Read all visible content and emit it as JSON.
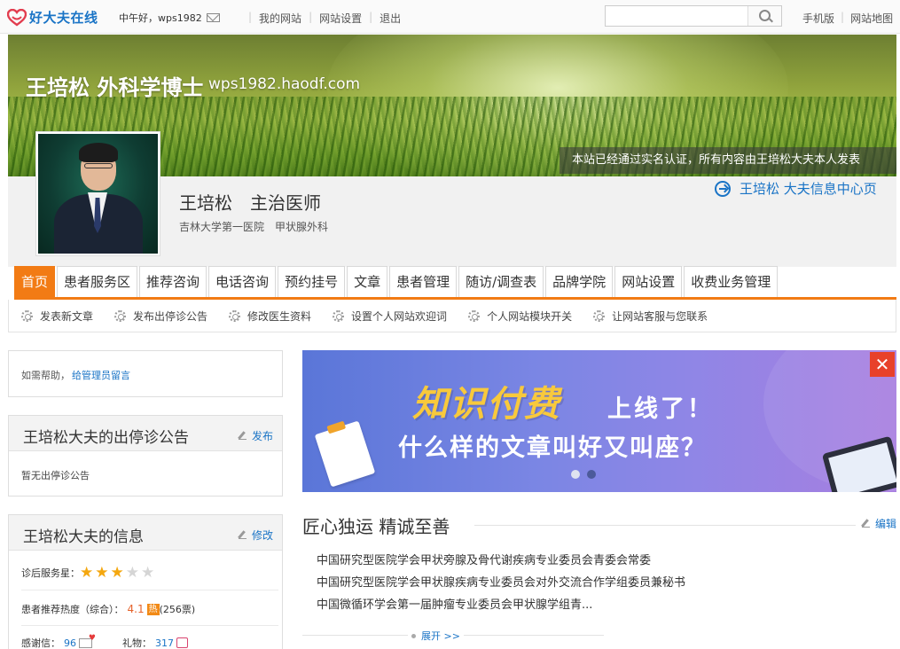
{
  "topbar": {
    "logo_text": "好大夫在线",
    "greeting": "中午好，wps1982",
    "links": [
      "我的网站",
      "网站设置",
      "退出"
    ],
    "search_placeholder": "",
    "right_links": [
      "手机版",
      "网站地图"
    ]
  },
  "banner": {
    "title": "王培松 外科学博士",
    "domain": "wps1982.haodf.com",
    "verify_text": "本站已经通过实名认证，所有内容由王培松大夫本人发表"
  },
  "profile": {
    "name_title": "王培松　主治医师",
    "hospital": "吉林大学第一医院　甲状腺外科",
    "info_center_link": "王培松 大夫信息中心页"
  },
  "nav": {
    "tabs": [
      "首页",
      "患者服务区",
      "推荐咨询",
      "电话咨询",
      "预约挂号",
      "文章",
      "患者管理",
      "随访/调查表",
      "品牌学院",
      "网站设置",
      "收费业务管理"
    ],
    "active": 0
  },
  "subbar": {
    "items": [
      "发表新文章",
      "发布出停诊公告",
      "修改医生资料",
      "设置个人网站欢迎词",
      "个人网站模块开关",
      "让网站客服与您联系"
    ]
  },
  "help": {
    "prefix": "如需帮助，",
    "link": "给管理员留言"
  },
  "notice": {
    "title": "王培松大夫的出停诊公告",
    "action": "发布",
    "body": "暂无出停诊公告"
  },
  "info": {
    "title": "王培松大夫的信息",
    "action": "修改",
    "service_stars_label": "诊后服务星：",
    "stars_filled": 3,
    "stars_total": 5,
    "hot_label": "患者推荐热度（综合）：",
    "hot_value": "4.1",
    "hot_badge": "热",
    "hot_votes": "(256票)",
    "thanks_label": "感谢信：",
    "thanks_value": "96",
    "gift_label": "礼物：",
    "gift_value": "317"
  },
  "promo": {
    "line1_highlight": "知识付费",
    "line1_rest": "上线了！",
    "line2": "什么样的文章叫好又叫座？",
    "close": "✕",
    "slides": 2,
    "active_slide": 1
  },
  "section": {
    "title": "匠心独运 精诚至善",
    "edit": "编辑",
    "bio": [
      "中国研究型医院学会甲状旁腺及骨代谢疾病专业委员会青委会常委",
      "中国研究型医院学会甲状腺疾病专业委员会对外交流合作学组委员兼秘书",
      "中国微循环学会第一届肿瘤专业委员会甲状腺学组青..."
    ],
    "expand": "展开 >>"
  },
  "colors": {
    "brand_blue": "#1a74c6",
    "accent_orange": "#f27b14",
    "star_gold": "#f4a70f",
    "close_red": "#e8412a"
  }
}
